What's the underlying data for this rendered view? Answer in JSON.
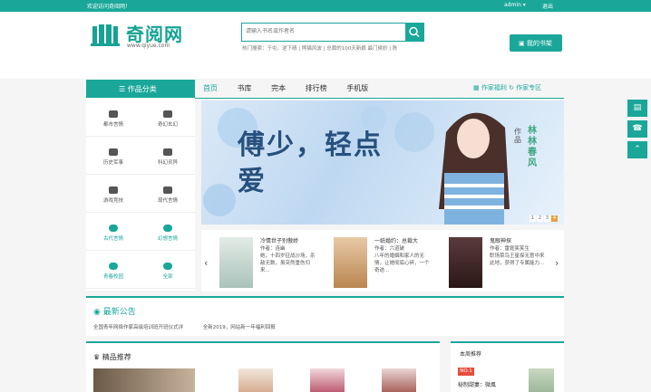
{
  "topbar": {
    "welcome": "欢迎访问奇阅网！",
    "user": "admin ▾",
    "logout": "退出"
  },
  "logo": {
    "name": "奇阅网",
    "url": "www.qiyue.com"
  },
  "search": {
    "placeholder": "请输入书名或作者名",
    "hotwords": "热门搜索：于屯，逆下晴 | 熊猫风波 | 总裁的100天新娘 最门侯妙 | 陈"
  },
  "shelf_button": "我的书架",
  "category_header": "作品分类",
  "nav": [
    "首页",
    "书库",
    "完本",
    "排行榜",
    "手机版"
  ],
  "author_links": [
    "作家福利",
    "作家专区"
  ],
  "categories": [
    {
      "label": "都市言情",
      "color": "dark"
    },
    {
      "label": "奇幻玄幻",
      "color": "dark"
    },
    {
      "label": "历史军事",
      "color": "dark"
    },
    {
      "label": "科幻灵异",
      "color": "dark"
    },
    {
      "label": "游戏竞技",
      "color": "dark"
    },
    {
      "label": "现代言情",
      "color": "dark"
    },
    {
      "label": "古代言情",
      "color": "teal"
    },
    {
      "label": "幻想言情",
      "color": "teal"
    },
    {
      "label": "青春校园",
      "color": "teal"
    },
    {
      "label": "全部",
      "color": "teal"
    }
  ],
  "banner": {
    "title": "傅少，轻点爱",
    "author_tag": "作品",
    "author": "林林春风",
    "pages": [
      "1",
      "2",
      "3",
      "4"
    ],
    "active_page": "4"
  },
  "featured_books": [
    {
      "title": "冷情世子别傲娇",
      "author": "作者：连幽",
      "desc": "她，十四岁征战沙场，杀敌无数，虽突然重伤归来..."
    },
    {
      "title": "一纸婚约：总裁大",
      "author": "作者：六道破",
      "desc": "八年的婚姻和家人的无情，让她彻底心碎，一个奇迹..."
    },
    {
      "title": "鬼眼神探",
      "author": "作者：雷霆笑笑生",
      "desc": "职场菜鸟王星探无意中来此地，获得了专属能力..."
    }
  ],
  "news": {
    "title": "最新公告",
    "items": [
      "全国青年网络作家高级培训班开班仪式详",
      "全新2019，网站新一年福利回报"
    ]
  },
  "picks": {
    "title": "精品推荐"
  },
  "weekly": {
    "title": "本周推荐",
    "rank": "NO.1",
    "book": "秘制甜妻：微風"
  },
  "side_tools": [
    "书架",
    "客服",
    "回到顶部"
  ]
}
